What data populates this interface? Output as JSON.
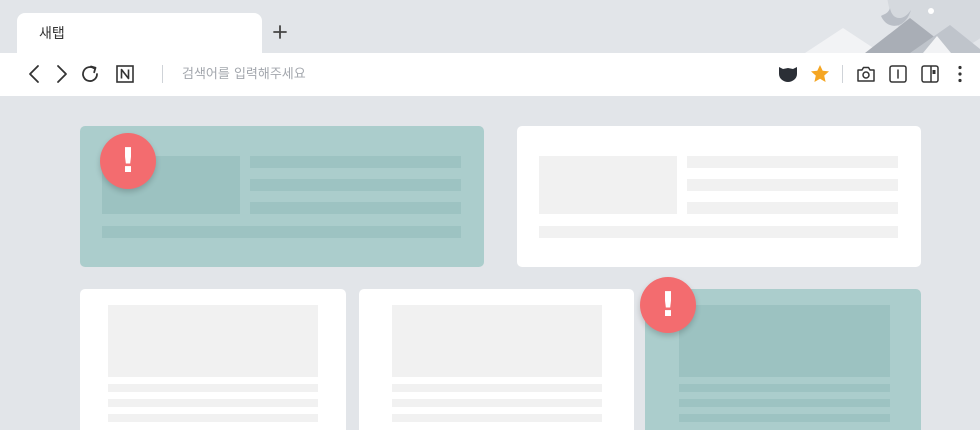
{
  "tab": {
    "title": "새탭",
    "new_tab_icon": "plus-icon"
  },
  "toolbar": {
    "icons": [
      "back-icon",
      "forward-icon",
      "reload-icon",
      "naver-home-icon"
    ],
    "address_placeholder": "검색어를 입력해주세요",
    "right_icons": [
      "shield-icon",
      "bookmark-star-icon",
      "capture-icon",
      "reader-icon",
      "sidebar-icon",
      "more-menu-icon"
    ]
  },
  "colors": {
    "highlight": "#abcdcc",
    "alert": "#f36c6f",
    "star": "#f5a623"
  },
  "alerts": [
    "!",
    "!"
  ]
}
